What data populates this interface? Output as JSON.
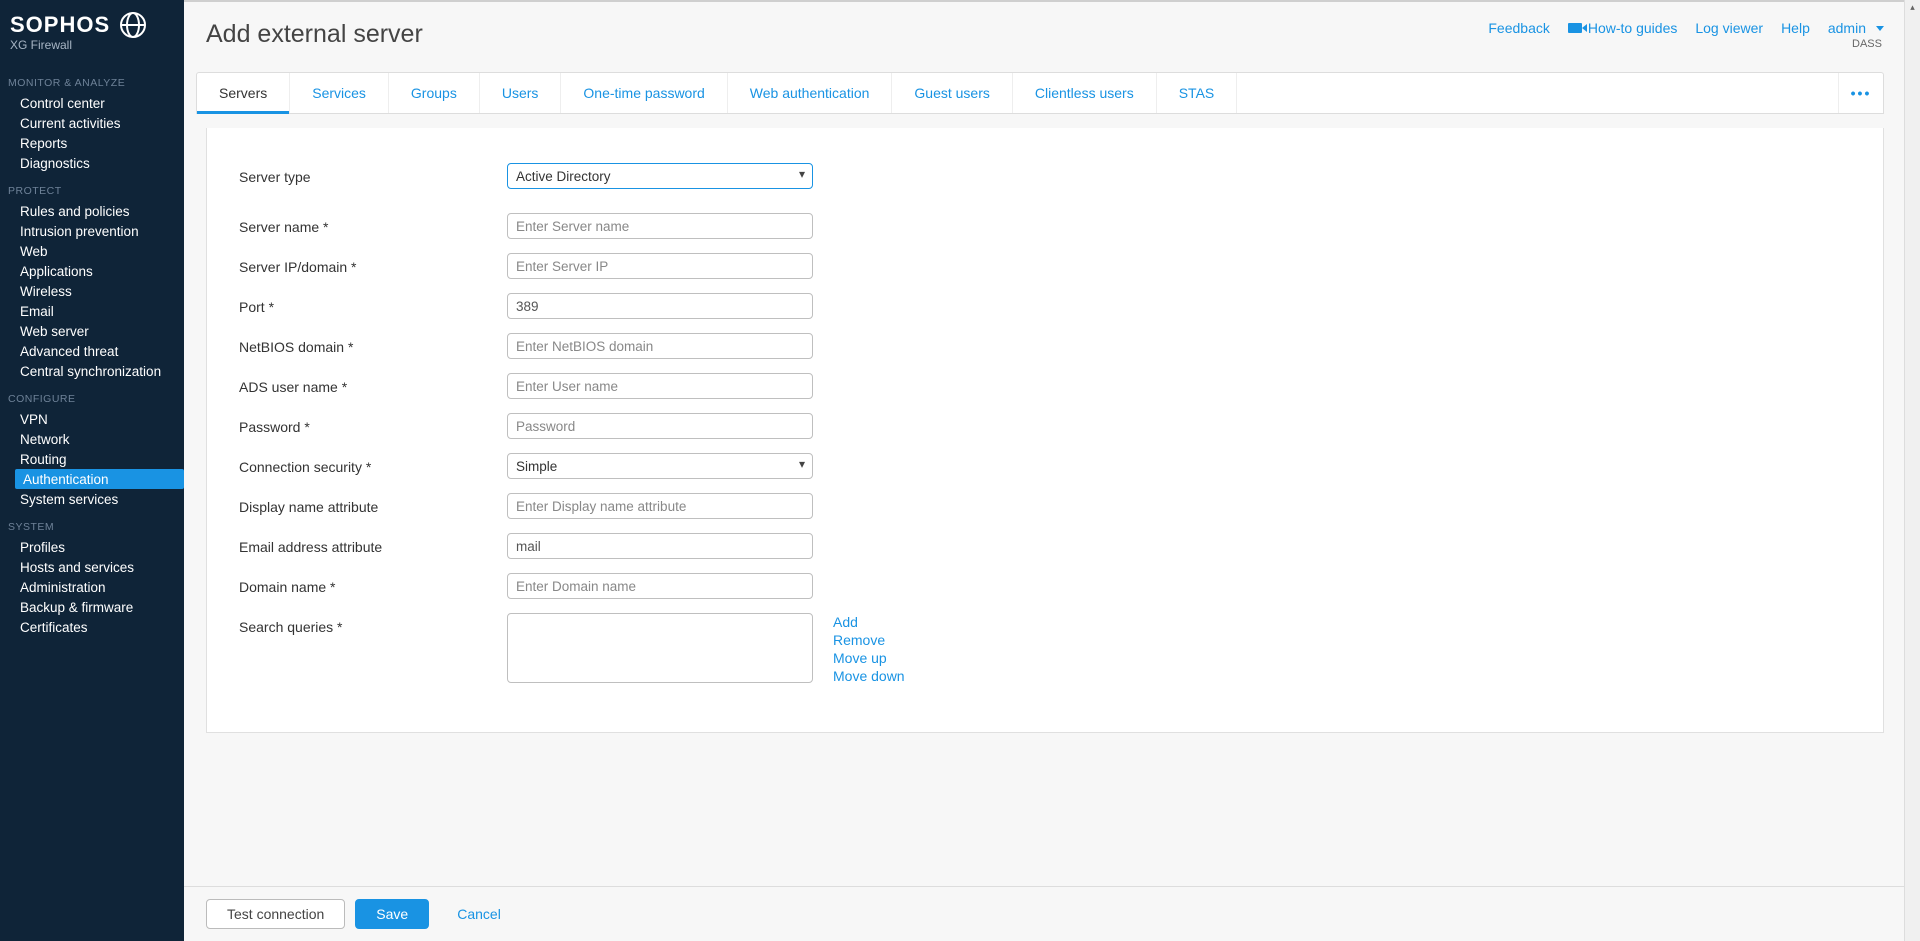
{
  "brand": {
    "name": "SOPHOS",
    "product": "XG Firewall"
  },
  "header": {
    "title": "Add external server",
    "links": {
      "feedback": "Feedback",
      "guides": "How-to guides",
      "log_viewer": "Log viewer",
      "help": "Help",
      "user": "admin"
    },
    "user_sub": "DASS"
  },
  "sidebar": {
    "sections": [
      {
        "title": "MONITOR & ANALYZE",
        "items": [
          "Control center",
          "Current activities",
          "Reports",
          "Diagnostics"
        ]
      },
      {
        "title": "PROTECT",
        "items": [
          "Rules and policies",
          "Intrusion prevention",
          "Web",
          "Applications",
          "Wireless",
          "Email",
          "Web server",
          "Advanced threat",
          "Central synchronization"
        ]
      },
      {
        "title": "CONFIGURE",
        "items": [
          "VPN",
          "Network",
          "Routing",
          "Authentication",
          "System services"
        ],
        "active_index": 3
      },
      {
        "title": "SYSTEM",
        "items": [
          "Profiles",
          "Hosts and services",
          "Administration",
          "Backup & firmware",
          "Certificates"
        ]
      }
    ]
  },
  "tabs": [
    "Servers",
    "Services",
    "Groups",
    "Users",
    "One-time password",
    "Web authentication",
    "Guest users",
    "Clientless users",
    "STAS"
  ],
  "active_tab": 0,
  "form": {
    "labels": {
      "server_type": "Server type",
      "server_name": "Server name *",
      "server_ip": "Server IP/domain *",
      "port": "Port *",
      "netbios": "NetBIOS domain *",
      "ads_user": "ADS user name *",
      "password": "Password *",
      "conn_sec": "Connection security *",
      "display_name_attr": "Display name attribute",
      "email_attr": "Email address attribute",
      "domain_name": "Domain name *",
      "search_queries": "Search queries *"
    },
    "placeholders": {
      "server_name": "Enter Server name",
      "server_ip": "Enter Server IP",
      "netbios": "Enter NetBIOS domain",
      "ads_user": "Enter User name",
      "password": "Password",
      "display_name_attr": "Enter Display name attribute",
      "domain_name": "Enter Domain name"
    },
    "values": {
      "server_type": "Active Directory",
      "port": "389",
      "conn_sec": "Simple",
      "email_attr": "mail"
    },
    "search_actions": {
      "add": "Add",
      "remove": "Remove",
      "move_up": "Move up",
      "move_down": "Move down"
    }
  },
  "buttons": {
    "test": "Test connection",
    "save": "Save",
    "cancel": "Cancel"
  }
}
